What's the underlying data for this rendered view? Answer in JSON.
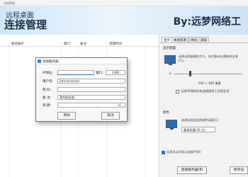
{
  "window": {
    "title": "远程管理"
  },
  "header": {
    "subtitle": "远程桌面",
    "title": "连接管理",
    "brand": "By:远梦网络工"
  },
  "table": {
    "columns": [
      "",
      "服务器IP",
      "端口",
      "备注",
      "到期时间"
    ]
  },
  "right_panel": {
    "tabs": [
      "显示",
      "本地资源",
      "体验",
      "高级"
    ],
    "display_group": "显示配置",
    "size_desc": "选择远程桌面的大小。向左移动以便拖到全屏(C)。",
    "slider_left": "小",
    "resolution": "640 × 480 像素",
    "multi_monitor": "全屏/将我的所有监视器用于远程会话",
    "color_group": "颜色",
    "color_desc": "选择远程会话的颜色深度(C)",
    "color_value": "最高质量(32 位)",
    "show_connection_bar": "全屏显示时显示连接栏(B)",
    "connect_button": "连接服务器(B)",
    "save_button": "保存设"
  },
  "dialog": {
    "title": "添加服务器",
    "address_label": "IP地址:",
    "port_label": "端口:",
    "port_value": "3389",
    "username_label": "用户名:",
    "username_value": "Administrator",
    "password_label": "密  码:",
    "remark_label": "备  注:",
    "remark_value": "我的服务器",
    "expire_label": "到  期:",
    "browse_label": "...",
    "add_button": "添加",
    "cancel_button": "取消"
  },
  "colors": {
    "header_bg": "#d0e7f8",
    "accent": "#1e6fd9"
  }
}
